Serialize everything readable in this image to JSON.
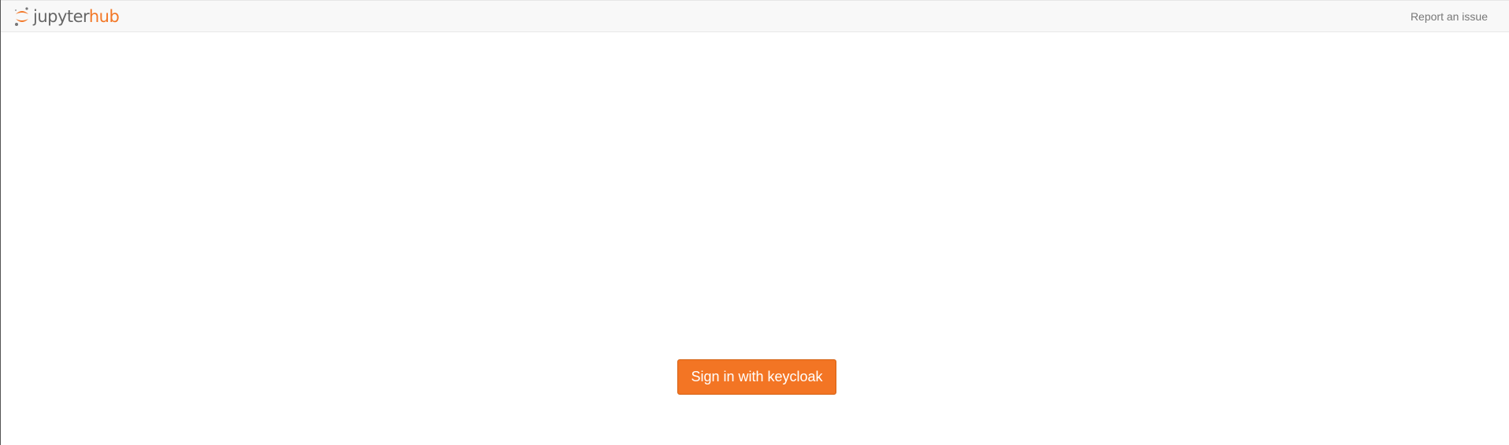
{
  "navbar": {
    "brand": {
      "part1": "jupyter",
      "part2": "hub",
      "icon": "jupyter-logo-icon"
    },
    "report_link": "Report an issue"
  },
  "login": {
    "button_label": "Sign in with keycloak"
  },
  "colors": {
    "accent": "#f37726",
    "button": "#f37524",
    "navbar_bg": "#f8f8f8",
    "link_text": "#777777"
  }
}
